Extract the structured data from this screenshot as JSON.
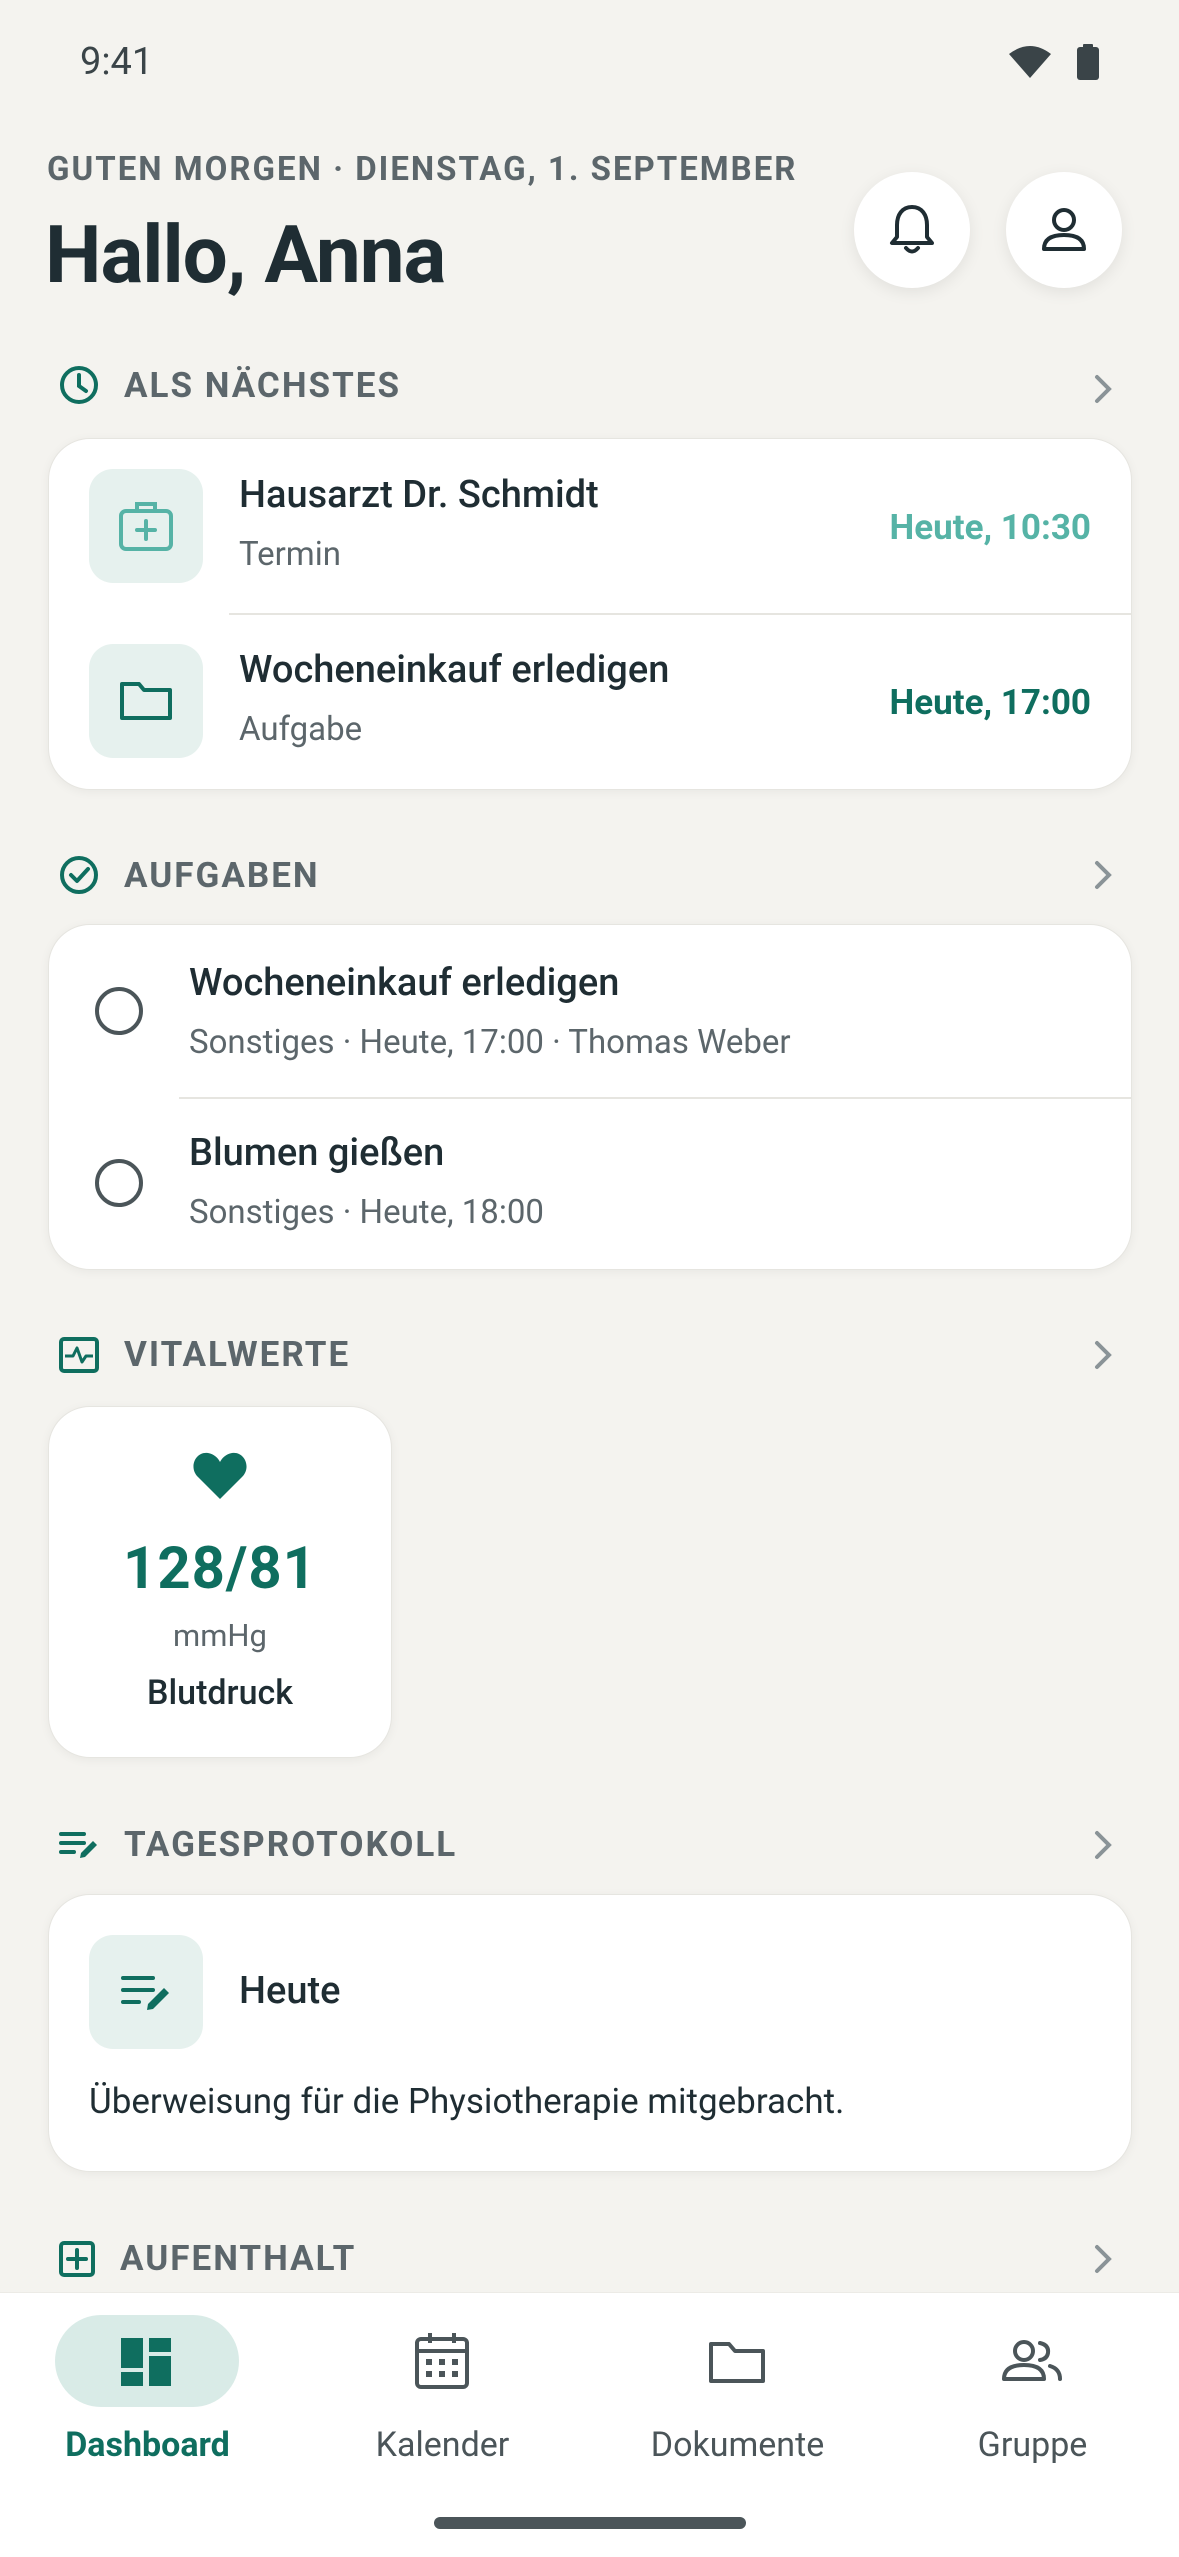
{
  "status": {
    "time": "9:41"
  },
  "header": {
    "greeting": "GUTEN MORGEN · DIENSTAG, 1. SEPTEMBER",
    "hello": "Hallo, Anna"
  },
  "sections": {
    "next": {
      "title": "ALS NÄCHSTES",
      "items": [
        {
          "title": "Hausarzt Dr. Schmidt",
          "sub": "Termin",
          "time": "Heute, 10:30"
        },
        {
          "title": "Wocheneinkauf erledigen",
          "sub": "Aufgabe",
          "time": "Heute, 17:00"
        }
      ]
    },
    "tasks": {
      "title": "AUFGABEN",
      "items": [
        {
          "title": "Wocheneinkauf erledigen",
          "sub": "Sonstiges · Heute, 17:00 · Thomas Weber"
        },
        {
          "title": "Blumen gießen",
          "sub": "Sonstiges · Heute, 18:00"
        }
      ]
    },
    "vitals": {
      "title": "VITALWERTE",
      "card": {
        "value": "128/81",
        "unit": "mmHg",
        "label": "Blutdruck"
      }
    },
    "log": {
      "title": "TAGESPROTOKOLL",
      "day": "Heute",
      "text": "Überweisung für die Physiotherapie mitgebracht."
    },
    "stay": {
      "title": "AUFENTHALT"
    }
  },
  "nav": {
    "items": [
      {
        "label": "Dashboard"
      },
      {
        "label": "Kalender"
      },
      {
        "label": "Dokumente"
      },
      {
        "label": "Gruppe"
      }
    ]
  },
  "colors": {
    "accent": "#0F6E5F",
    "accent_light": "#56B3A6",
    "tile_bg": "#E6F1EE",
    "nav_active_bg": "#D9EBE7"
  }
}
